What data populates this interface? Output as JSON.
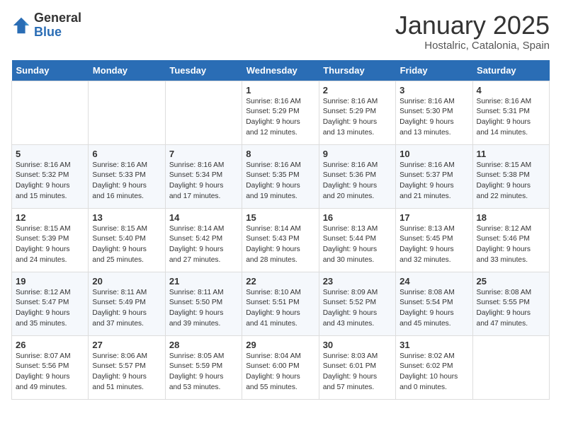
{
  "header": {
    "logo_line1": "General",
    "logo_line2": "Blue",
    "title": "January 2025",
    "subtitle": "Hostalric, Catalonia, Spain"
  },
  "weekdays": [
    "Sunday",
    "Monday",
    "Tuesday",
    "Wednesday",
    "Thursday",
    "Friday",
    "Saturday"
  ],
  "weeks": [
    [
      {
        "day": "",
        "detail": ""
      },
      {
        "day": "",
        "detail": ""
      },
      {
        "day": "",
        "detail": ""
      },
      {
        "day": "1",
        "detail": "Sunrise: 8:16 AM\nSunset: 5:29 PM\nDaylight: 9 hours\nand 12 minutes."
      },
      {
        "day": "2",
        "detail": "Sunrise: 8:16 AM\nSunset: 5:29 PM\nDaylight: 9 hours\nand 13 minutes."
      },
      {
        "day": "3",
        "detail": "Sunrise: 8:16 AM\nSunset: 5:30 PM\nDaylight: 9 hours\nand 13 minutes."
      },
      {
        "day": "4",
        "detail": "Sunrise: 8:16 AM\nSunset: 5:31 PM\nDaylight: 9 hours\nand 14 minutes."
      }
    ],
    [
      {
        "day": "5",
        "detail": "Sunrise: 8:16 AM\nSunset: 5:32 PM\nDaylight: 9 hours\nand 15 minutes."
      },
      {
        "day": "6",
        "detail": "Sunrise: 8:16 AM\nSunset: 5:33 PM\nDaylight: 9 hours\nand 16 minutes."
      },
      {
        "day": "7",
        "detail": "Sunrise: 8:16 AM\nSunset: 5:34 PM\nDaylight: 9 hours\nand 17 minutes."
      },
      {
        "day": "8",
        "detail": "Sunrise: 8:16 AM\nSunset: 5:35 PM\nDaylight: 9 hours\nand 19 minutes."
      },
      {
        "day": "9",
        "detail": "Sunrise: 8:16 AM\nSunset: 5:36 PM\nDaylight: 9 hours\nand 20 minutes."
      },
      {
        "day": "10",
        "detail": "Sunrise: 8:16 AM\nSunset: 5:37 PM\nDaylight: 9 hours\nand 21 minutes."
      },
      {
        "day": "11",
        "detail": "Sunrise: 8:15 AM\nSunset: 5:38 PM\nDaylight: 9 hours\nand 22 minutes."
      }
    ],
    [
      {
        "day": "12",
        "detail": "Sunrise: 8:15 AM\nSunset: 5:39 PM\nDaylight: 9 hours\nand 24 minutes."
      },
      {
        "day": "13",
        "detail": "Sunrise: 8:15 AM\nSunset: 5:40 PM\nDaylight: 9 hours\nand 25 minutes."
      },
      {
        "day": "14",
        "detail": "Sunrise: 8:14 AM\nSunset: 5:42 PM\nDaylight: 9 hours\nand 27 minutes."
      },
      {
        "day": "15",
        "detail": "Sunrise: 8:14 AM\nSunset: 5:43 PM\nDaylight: 9 hours\nand 28 minutes."
      },
      {
        "day": "16",
        "detail": "Sunrise: 8:13 AM\nSunset: 5:44 PM\nDaylight: 9 hours\nand 30 minutes."
      },
      {
        "day": "17",
        "detail": "Sunrise: 8:13 AM\nSunset: 5:45 PM\nDaylight: 9 hours\nand 32 minutes."
      },
      {
        "day": "18",
        "detail": "Sunrise: 8:12 AM\nSunset: 5:46 PM\nDaylight: 9 hours\nand 33 minutes."
      }
    ],
    [
      {
        "day": "19",
        "detail": "Sunrise: 8:12 AM\nSunset: 5:47 PM\nDaylight: 9 hours\nand 35 minutes."
      },
      {
        "day": "20",
        "detail": "Sunrise: 8:11 AM\nSunset: 5:49 PM\nDaylight: 9 hours\nand 37 minutes."
      },
      {
        "day": "21",
        "detail": "Sunrise: 8:11 AM\nSunset: 5:50 PM\nDaylight: 9 hours\nand 39 minutes."
      },
      {
        "day": "22",
        "detail": "Sunrise: 8:10 AM\nSunset: 5:51 PM\nDaylight: 9 hours\nand 41 minutes."
      },
      {
        "day": "23",
        "detail": "Sunrise: 8:09 AM\nSunset: 5:52 PM\nDaylight: 9 hours\nand 43 minutes."
      },
      {
        "day": "24",
        "detail": "Sunrise: 8:08 AM\nSunset: 5:54 PM\nDaylight: 9 hours\nand 45 minutes."
      },
      {
        "day": "25",
        "detail": "Sunrise: 8:08 AM\nSunset: 5:55 PM\nDaylight: 9 hours\nand 47 minutes."
      }
    ],
    [
      {
        "day": "26",
        "detail": "Sunrise: 8:07 AM\nSunset: 5:56 PM\nDaylight: 9 hours\nand 49 minutes."
      },
      {
        "day": "27",
        "detail": "Sunrise: 8:06 AM\nSunset: 5:57 PM\nDaylight: 9 hours\nand 51 minutes."
      },
      {
        "day": "28",
        "detail": "Sunrise: 8:05 AM\nSunset: 5:59 PM\nDaylight: 9 hours\nand 53 minutes."
      },
      {
        "day": "29",
        "detail": "Sunrise: 8:04 AM\nSunset: 6:00 PM\nDaylight: 9 hours\nand 55 minutes."
      },
      {
        "day": "30",
        "detail": "Sunrise: 8:03 AM\nSunset: 6:01 PM\nDaylight: 9 hours\nand 57 minutes."
      },
      {
        "day": "31",
        "detail": "Sunrise: 8:02 AM\nSunset: 6:02 PM\nDaylight: 10 hours\nand 0 minutes."
      },
      {
        "day": "",
        "detail": ""
      }
    ]
  ]
}
